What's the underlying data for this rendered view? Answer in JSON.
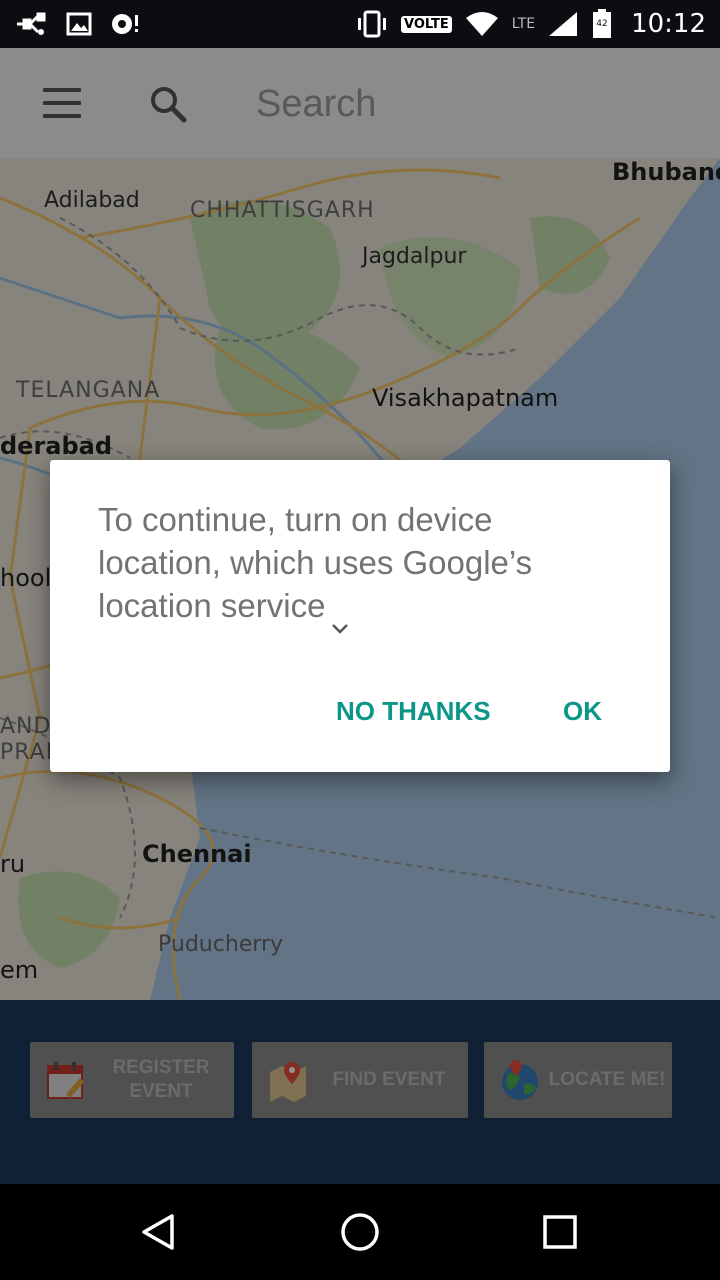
{
  "status_bar": {
    "volte_label": "VOLTE",
    "network_label": "LTE",
    "battery_level": "42",
    "time": "10:12",
    "icons": [
      "usb-icon",
      "image-icon",
      "sync-icon",
      "vibrate-icon",
      "wifi-icon",
      "signal-icon",
      "battery-icon"
    ]
  },
  "app_bar": {
    "search_placeholder": "Search",
    "icons": [
      "menu-icon",
      "search-icon"
    ]
  },
  "map": {
    "labels": {
      "bhubaneswar": "Bhubane",
      "adilabad": "Adilabad",
      "chhattisgarh": "CHHATTISGARH",
      "jagdalpur": "Jagdalpur",
      "telangana": "TELANGANA",
      "visakhapatnam": "Visakhapatnam",
      "hyderabad": "derabad",
      "kurnool": "hool",
      "andhra_1": "AND",
      "andhra_2": "PRAD",
      "chennai": "Chennai",
      "bengaluru": "ru",
      "puducherry": "Puducherry",
      "salem": "em"
    },
    "colors": {
      "land": "#e8e4d8",
      "water": "#a9c8e6",
      "forest": "#c5dcb0",
      "roads": "#f2c66b"
    }
  },
  "actions": {
    "register": {
      "line1": "REGISTER",
      "line2": "EVENT",
      "icon": "calendar-icon"
    },
    "find": {
      "label": "FIND EVENT",
      "icon": "map-pin-icon"
    },
    "locate": {
      "label": "LOCATE ME!",
      "icon": "globe-icon"
    }
  },
  "dialog": {
    "message": "To continue, turn on device location, which uses Google’s location service",
    "no_thanks_label": "NO THANKS",
    "ok_label": "OK",
    "accent_color": "#0c9688"
  },
  "nav_bar": {
    "icons": [
      "back-icon",
      "home-icon",
      "recents-icon"
    ]
  }
}
